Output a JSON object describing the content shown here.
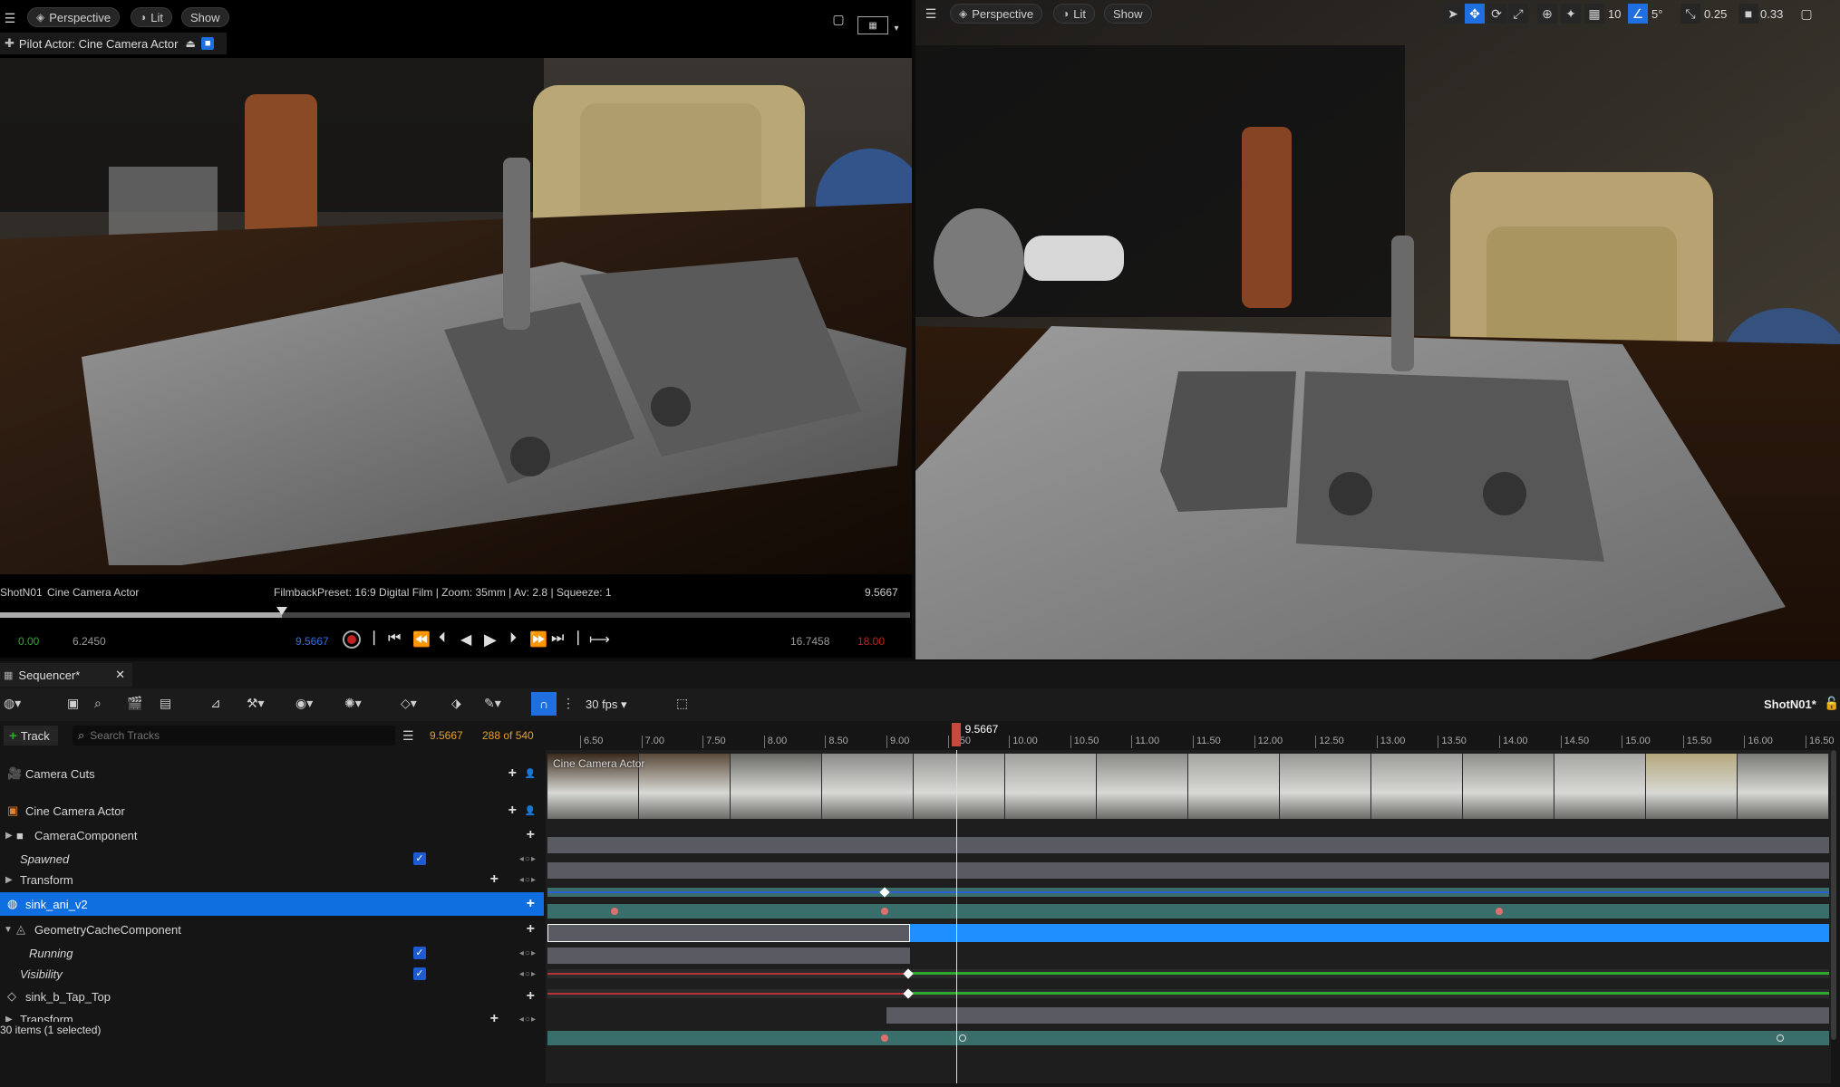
{
  "left_viewport": {
    "view_mode": "Perspective",
    "lighting": "Lit",
    "show": "Show",
    "pilot_label": "Pilot Actor: Cine Camera Actor",
    "shot_label": "ShotN01",
    "camera_label": "Cine Camera Actor",
    "filmback_info": "FilmbackPreset: 16:9 Digital Film | Zoom: 35mm | Av: 2.8 | Squeeze: 1",
    "current_time": "9.5667",
    "transport": {
      "start": "0.00",
      "in": "6.2450",
      "current": "9.5667",
      "out": "16.7458",
      "end": "18.00"
    },
    "scrub_progress": 0.31
  },
  "right_viewport": {
    "view_mode": "Perspective",
    "lighting": "Lit",
    "show": "Show",
    "grid_snap": "10",
    "angle_snap": "5°",
    "scale_snap": "0.25",
    "camera_speed": "0.33"
  },
  "sequencer": {
    "tab_title": "Sequencer*",
    "fps": "30 fps",
    "shot_name": "ShotN01*",
    "add_track": "Track",
    "search_placeholder": "Search Tracks",
    "current_time": "9.5667",
    "frame_info": "288 of 540",
    "playhead_time": "9.5667",
    "playhead_value": 9.5667,
    "status": "30 items (1 selected)",
    "time_ticks": [
      "6.50",
      "7.00",
      "7.50",
      "8.00",
      "8.50",
      "9.00",
      "9.50",
      "10.00",
      "10.50",
      "11.00",
      "11.50",
      "12.00",
      "12.50",
      "13.00",
      "13.50",
      "14.00",
      "14.50",
      "15.00",
      "15.50",
      "16.00",
      "16.50"
    ],
    "camera_cut_label": "Cine Camera Actor",
    "tracks": [
      {
        "label": "Camera Cuts",
        "type": "camera-cuts"
      },
      {
        "label": "Cine Camera Actor",
        "type": "actor"
      },
      {
        "label": "CameraComponent",
        "type": "component"
      },
      {
        "label": "Spawned",
        "type": "bool",
        "checked": true
      },
      {
        "label": "Transform",
        "type": "transform"
      },
      {
        "label": "sink_ani_v2",
        "type": "actor",
        "selected": true
      },
      {
        "label": "GeometryCacheComponent",
        "type": "component"
      },
      {
        "label": "Running",
        "type": "bool",
        "checked": true
      },
      {
        "label": "Visibility",
        "type": "bool",
        "checked": true
      },
      {
        "label": "sink_b_Tap_Top",
        "type": "actor"
      },
      {
        "label": "Transform",
        "type": "transform"
      }
    ]
  },
  "colors": {
    "accent": "#1f8fff",
    "selected_row": "#0f6fe0",
    "playhead": "#c44a3a",
    "current_time": "#e0a030",
    "key_red": "#e07070",
    "curve_green": "#2fa830",
    "curve_red": "#b83434"
  }
}
